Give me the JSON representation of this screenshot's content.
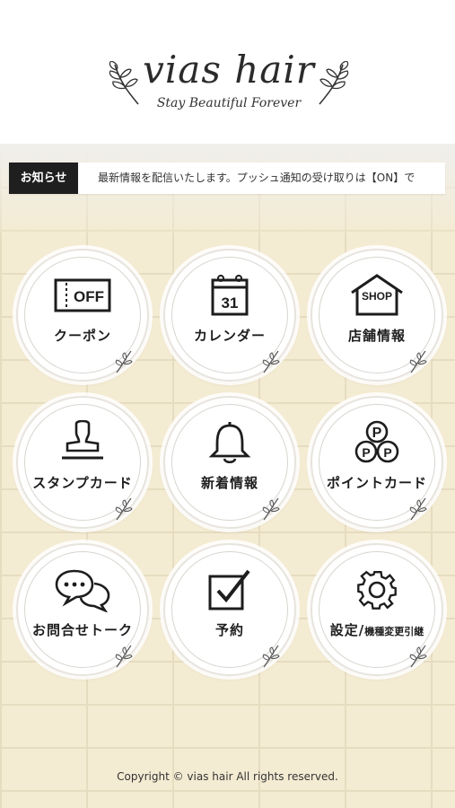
{
  "brand": {
    "name": "vias hair",
    "tagline": "Stay Beautiful Forever"
  },
  "news": {
    "label": "お知らせ",
    "text": "最新情報を配信いたします。プッシュ通知の受け取りは【ON】で"
  },
  "menu": {
    "items": [
      {
        "label": "クーポン",
        "icon": "coupon-off-icon"
      },
      {
        "label": "カレンダー",
        "icon": "calendar-icon"
      },
      {
        "label": "店舗情報",
        "icon": "shop-icon"
      },
      {
        "label": "スタンプカード",
        "icon": "stamp-icon"
      },
      {
        "label": "新着情報",
        "icon": "bell-icon"
      },
      {
        "label": "ポイントカード",
        "icon": "points-icon"
      },
      {
        "label": "お問合せトーク",
        "icon": "chat-icon"
      },
      {
        "label": "予約",
        "icon": "checkbox-icon"
      },
      {
        "label": "設定/",
        "label_small": "機種変更引継",
        "icon": "gear-icon"
      }
    ]
  },
  "icon_text": {
    "off": "OFF",
    "calendar_day": "31",
    "shop": "SHOP",
    "point": "P"
  },
  "footer": {
    "copyright": "Copyright © vias hair All rights reserved."
  }
}
